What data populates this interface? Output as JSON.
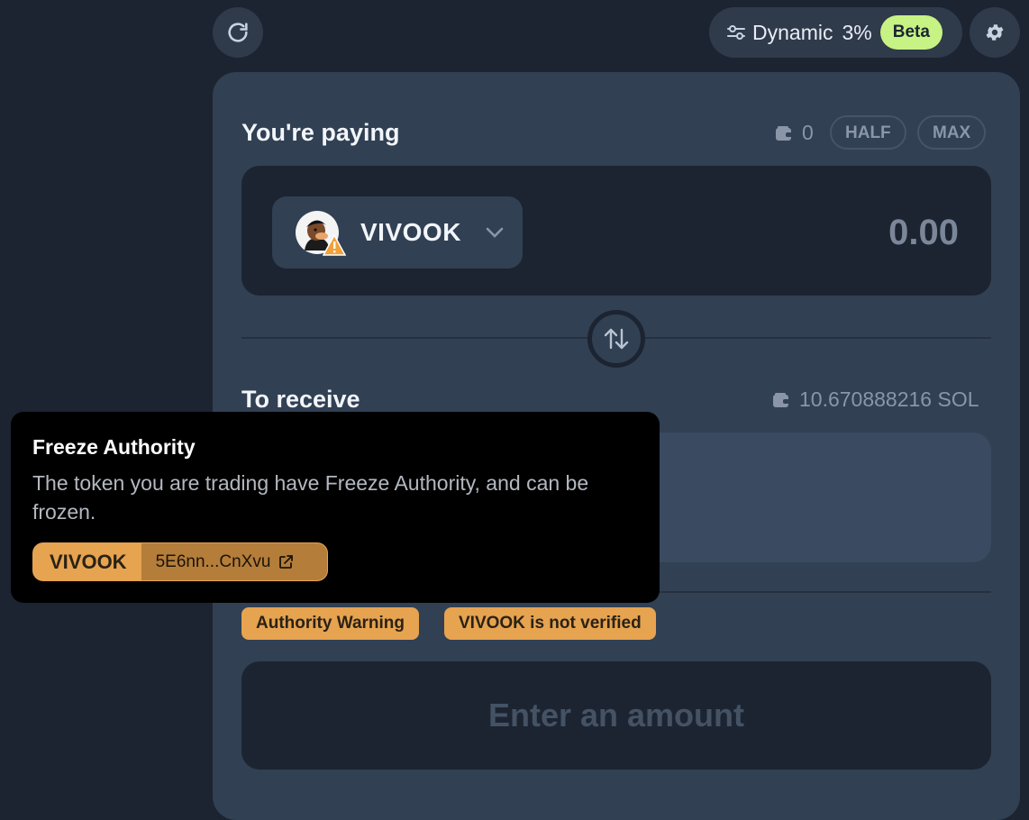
{
  "toolbar": {
    "refresh_icon": "refresh-icon",
    "slippage_mode": "Dynamic",
    "slippage_value": "3%",
    "beta_label": "Beta",
    "settings_icon": "gear-icon"
  },
  "paying": {
    "title": "You're paying",
    "balance": "0",
    "half_label": "HALF",
    "max_label": "MAX",
    "token_symbol": "VIVOOK",
    "amount": "0.00"
  },
  "receiving": {
    "title": "To receive",
    "balance": "10.670888216 SOL"
  },
  "warnings": {
    "authority_label": "Authority Warning",
    "verified_label": "VIVOOK is not verified"
  },
  "cta": {
    "label": "Enter an amount"
  },
  "tooltip": {
    "title": "Freeze Authority",
    "body": "The token you are trading have Freeze Authority, and can be frozen.",
    "token_symbol": "VIVOOK",
    "token_address": "5E6nn...CnXvu"
  },
  "colors": {
    "accent_warning": "#e6a350",
    "beta": "#c7f284",
    "card": "#314053",
    "background": "#1c2431"
  }
}
